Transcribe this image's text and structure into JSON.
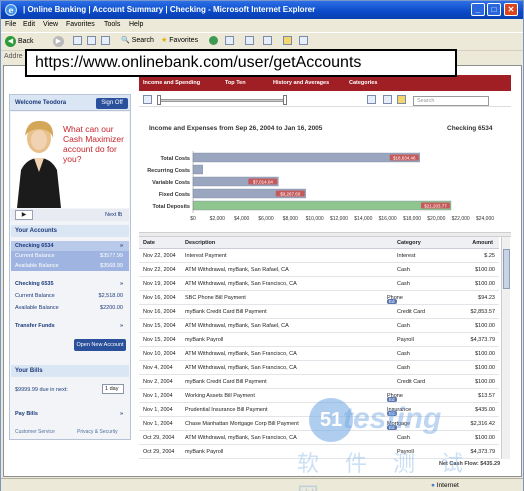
{
  "window": {
    "title": "| Online Banking | Account Summary | Checking - Microsoft Internet Explorer",
    "min_glyph": "_",
    "max_glyph": "□",
    "close_glyph": "✕",
    "app_glyph": "e"
  },
  "menu": [
    "File",
    "Edit",
    "View",
    "Favorites",
    "Tools",
    "Help"
  ],
  "toolbar": {
    "back": "Back",
    "search": "Search",
    "favorites": "Favorites"
  },
  "address": {
    "label": "Addre",
    "url": "https://www.onlinebank.com/user/getAccounts"
  },
  "sidebar": {
    "welcome": "Welcome Teodora",
    "signoff": "Sign Off",
    "promo_text": "What can our Cash Maximizer account do for you?",
    "play": "▶",
    "next": "Next ℔",
    "accounts_header": "Your Accounts",
    "accounts": [
      {
        "name": "Checking 6534",
        "arrow": "»",
        "rows": [
          {
            "label": "Current Balance",
            "value": "$3577.99"
          },
          {
            "label": "Available Balance",
            "value": "$3568.99"
          }
        ]
      },
      {
        "name": "Checking 6535",
        "arrow": "»",
        "rows": [
          {
            "label": "Current Balance",
            "value": "$2,518.00"
          },
          {
            "label": "Available Balance",
            "value": "$2200.00"
          }
        ]
      }
    ],
    "transfer": "Transfer Funds",
    "transfer_arrow": "»",
    "open_account": "Open New Account",
    "bills_header": "Your Bills",
    "bills_due": "$9999.99 due in next:",
    "bills_days": "1 day",
    "pay_bills": "Pay Bills",
    "pay_arrow": "»",
    "customer_service": "Customer Service",
    "privacy": "Privacy & Security"
  },
  "main": {
    "tabs": [
      "Income and Spending",
      "Top Ten",
      "History and Averages",
      "Categories"
    ],
    "search_placeholder": "Search",
    "chart_title": "Income and Expenses from Sep 26, 2004 to Jan 16, 2005",
    "account_label": "Checking 6534",
    "columns": {
      "date": "Date",
      "description": "Description",
      "category": "Category",
      "amount": "Amount"
    },
    "transactions": [
      {
        "date": "Nov 22, 2004",
        "desc": "Interest Payment",
        "cat": "Interest",
        "amt": "$.25",
        "badge": ""
      },
      {
        "date": "Nov 22, 2004",
        "desc": "ATM Withdrawal, myBank, San Rafael, CA",
        "cat": "Cash",
        "amt": "$100.00",
        "badge": ""
      },
      {
        "date": "Nov 19, 2004",
        "desc": "ATM Withdrawal, myBank, San Francisco, CA",
        "cat": "Cash",
        "amt": "$100.00",
        "badge": ""
      },
      {
        "date": "Nov 16, 2004",
        "desc": "SBC Phone Bill Payment",
        "cat": "Phone",
        "amt": "$94.23",
        "badge": "Ed"
      },
      {
        "date": "Nov 16, 2004",
        "desc": "myBank Credit Card Bill Payment",
        "cat": "Credit Card",
        "amt": "$2,853.57",
        "badge": ""
      },
      {
        "date": "Nov 15, 2004",
        "desc": "ATM Withdrawal, myBank, San Rafael, CA",
        "cat": "Cash",
        "amt": "$100.00",
        "badge": ""
      },
      {
        "date": "Nov 15, 2004",
        "desc": "myBank Payroll",
        "cat": "Payroll",
        "amt": "$4,373.79",
        "badge": ""
      },
      {
        "date": "Nov 10, 2004",
        "desc": "ATM Withdrawal, myBank, San Francisco, CA",
        "cat": "Cash",
        "amt": "$100.00",
        "badge": ""
      },
      {
        "date": "Nov 4, 2004",
        "desc": "ATM Withdrawal, myBank, San Francisco, CA",
        "cat": "Cash",
        "amt": "$100.00",
        "badge": ""
      },
      {
        "date": "Nov 2, 2004",
        "desc": "myBank Credit Card Bill Payment",
        "cat": "Credit Card",
        "amt": "$100.00",
        "badge": ""
      },
      {
        "date": "Nov 1, 2004",
        "desc": "Working Assets Bill Payment",
        "cat": "Phone",
        "amt": "$13.57",
        "badge": "Ed"
      },
      {
        "date": "Nov 1, 2004",
        "desc": "Prudential Insurance Bill Payment",
        "cat": "Insurance",
        "amt": "$435.00",
        "badge": "Ed"
      },
      {
        "date": "Nov 1, 2004",
        "desc": "Chase Manhattan Mortgage Corp Bill Payment",
        "cat": "Mortgage",
        "amt": "$2,316.42",
        "badge": "Ed"
      },
      {
        "date": "Oct 29, 2004",
        "desc": "ATM Withdrawal, myBank, San Francisco, CA",
        "cat": "Cash",
        "amt": "$100.00",
        "badge": ""
      },
      {
        "date": "Oct 29, 2004",
        "desc": "myBank Payroll",
        "cat": "Payroll",
        "amt": "$4,373.79",
        "badge": ""
      }
    ],
    "net_cash_flow": "Net Cash Flow: $435.29"
  },
  "status": {
    "zone": "Internet"
  },
  "watermark": {
    "letter": "51",
    "word": "testing",
    "cjk": "软件测试网"
  },
  "colors": {
    "nav_red": "#9f1f24",
    "costs_bar": "#9aa6bf",
    "deposits_bar": "#8fc68f",
    "cost_label": "#c55a5a",
    "deposit_label": "#c55a5a"
  },
  "chart_data": {
    "type": "bar",
    "orientation": "horizontal",
    "title": "Income and Expenses from Sep 26, 2004 to Jan 16, 2005",
    "categories": [
      "Total Costs",
      "Recurring Costs",
      "Variable Costs",
      "Fixed Costs",
      "Total Deposits"
    ],
    "values": [
      18634.46,
      800,
      7014.04,
      9267.6,
      21203.77
    ],
    "value_labels": [
      "$18,634.46",
      "",
      "$7,014.04",
      "$9,267.60",
      "$21,203.77"
    ],
    "x_ticks": [
      "$0",
      "$2,000",
      "$4,000",
      "$6,000",
      "$8,000",
      "$10,000",
      "$12,000",
      "$14,000",
      "$16,000",
      "$18,000",
      "$20,000",
      "$22,000",
      "$24,000"
    ],
    "xlim": [
      0,
      24000
    ],
    "grid": false
  }
}
